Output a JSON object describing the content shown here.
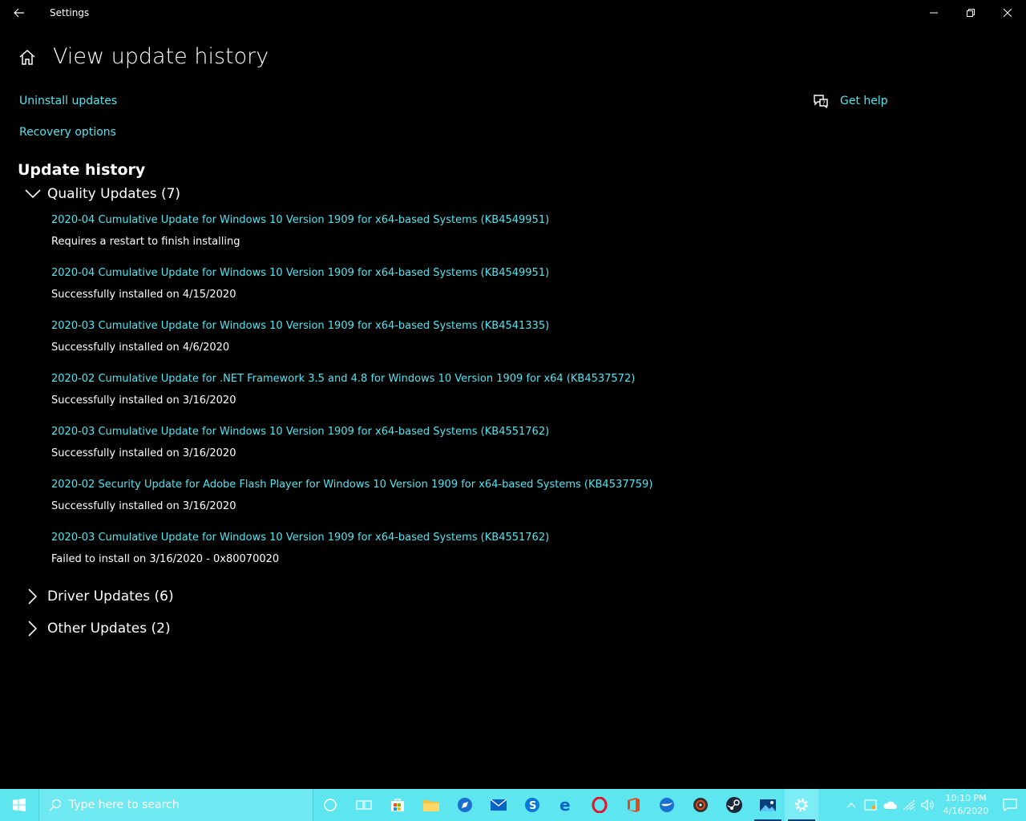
{
  "window": {
    "title": "Settings"
  },
  "header": {
    "page_title": "View update history"
  },
  "links": {
    "uninstall": "Uninstall updates",
    "recovery": "Recovery options",
    "get_help": "Get help"
  },
  "history": {
    "title": "Update history",
    "quality": {
      "label": "Quality Updates (7)",
      "items": [
        {
          "name": "2020-04 Cumulative Update for Windows 10 Version 1909 for x64-based Systems (KB4549951)",
          "status": "Requires a restart to finish installing"
        },
        {
          "name": "2020-04 Cumulative Update for Windows 10 Version 1909 for x64-based Systems (KB4549951)",
          "status": "Successfully installed on 4/15/2020"
        },
        {
          "name": "2020-03 Cumulative Update for Windows 10 Version 1909 for x64-based Systems (KB4541335)",
          "status": "Successfully installed on 4/6/2020"
        },
        {
          "name": "2020-02 Cumulative Update for .NET Framework 3.5 and 4.8 for Windows 10 Version 1909 for x64 (KB4537572)",
          "status": "Successfully installed on 3/16/2020"
        },
        {
          "name": "2020-03 Cumulative Update for Windows 10 Version 1909 for x64-based Systems (KB4551762)",
          "status": "Successfully installed on 3/16/2020"
        },
        {
          "name": "2020-02 Security Update for Adobe Flash Player for Windows 10 Version 1909 for x64-based Systems (KB4537759)",
          "status": "Successfully installed on 3/16/2020"
        },
        {
          "name": "2020-03 Cumulative Update for Windows 10 Version 1909 for x64-based Systems (KB4551762)",
          "status": "Failed to install on 3/16/2020 - 0x80070020"
        }
      ]
    },
    "driver": {
      "label": "Driver Updates (6)"
    },
    "other": {
      "label": "Other Updates (2)"
    }
  },
  "taskbar": {
    "search_placeholder": "Type here to search",
    "time": "10:10 PM",
    "date": "4/16/2020"
  },
  "colors": {
    "link": "#57e3ef",
    "taskbar": "#5ee6f0",
    "background": "#000000"
  }
}
